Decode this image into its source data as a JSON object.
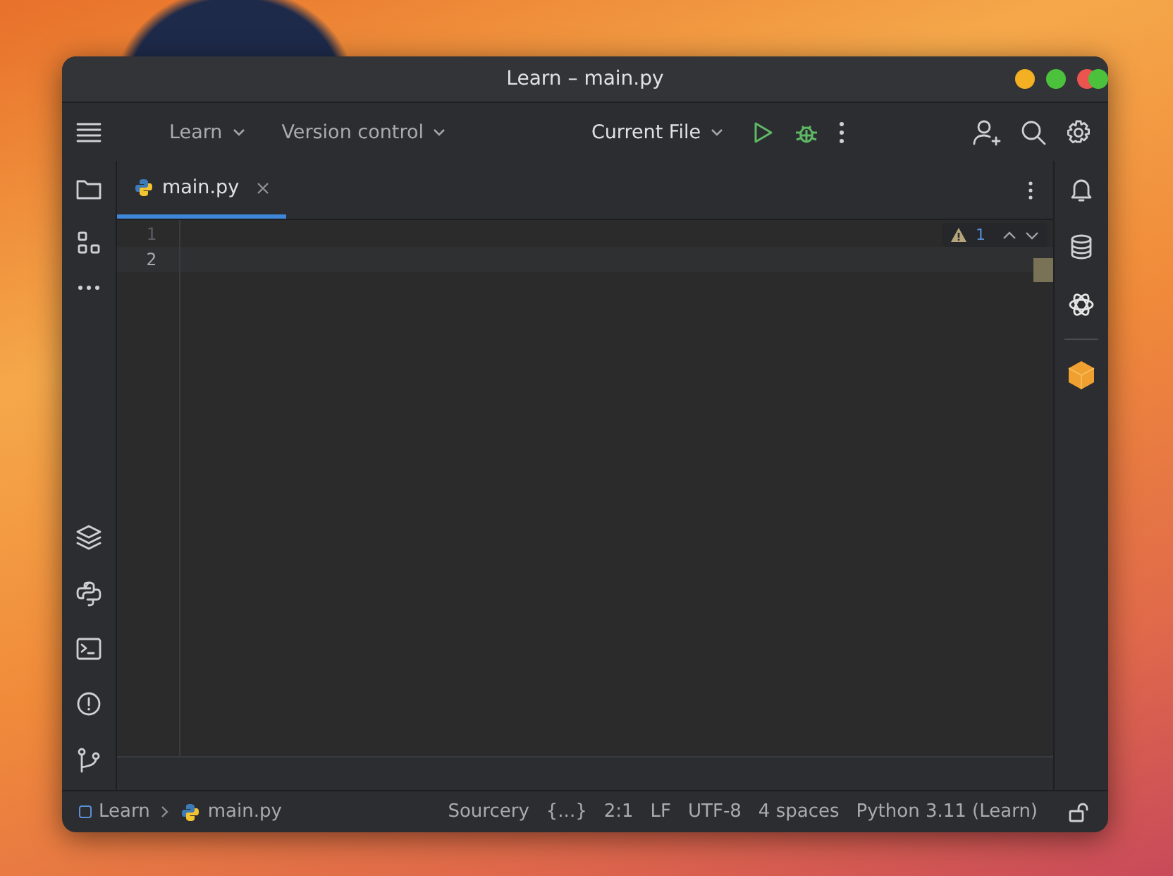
{
  "window": {
    "title": "Learn – main.py"
  },
  "toolbar": {
    "project": "Learn",
    "vcs": "Version control",
    "run_config": "Current File"
  },
  "tabs": [
    {
      "label": "main.py",
      "selected": true
    }
  ],
  "editor": {
    "lines": [
      {
        "number": "1",
        "current": false
      },
      {
        "number": "2",
        "current": true
      }
    ],
    "warnings": "1"
  },
  "status_bar": {
    "breadcrumbs": [
      "Learn",
      "main.py"
    ],
    "items": [
      "Sourcery",
      "{...}",
      "2:1",
      "LF",
      "UTF-8",
      "4 spaces",
      "Python 3.11 (Learn)"
    ]
  }
}
